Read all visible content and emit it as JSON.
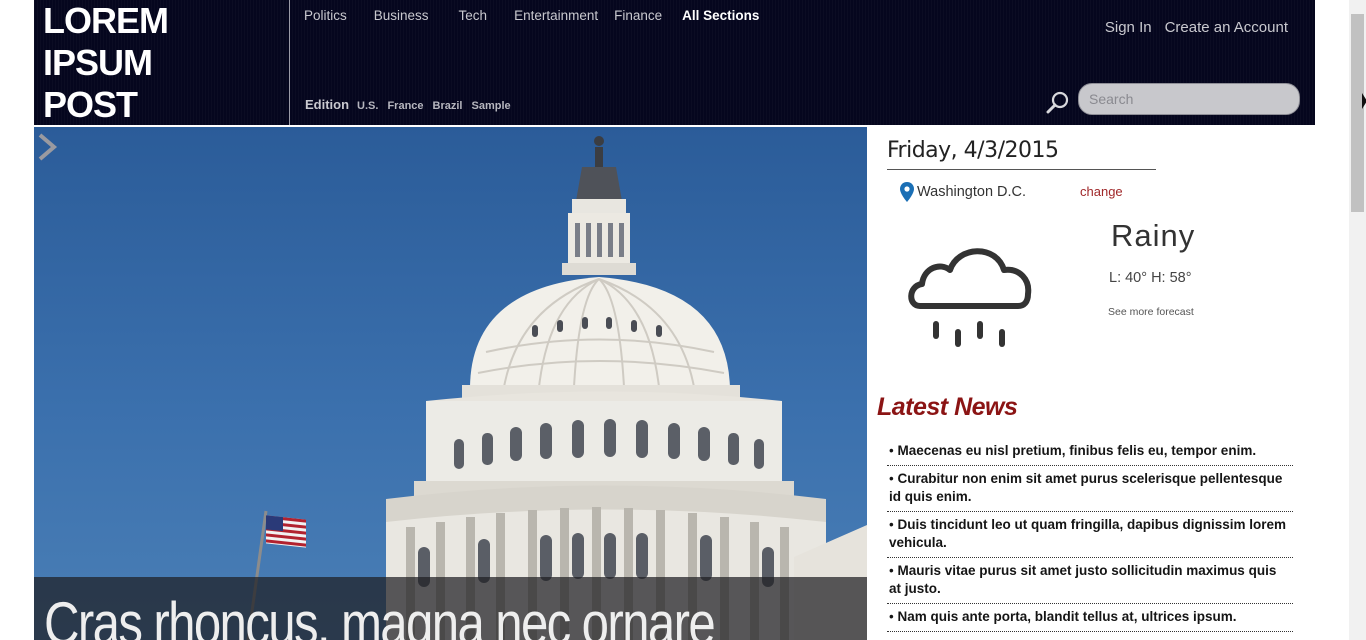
{
  "header": {
    "logo_lines": [
      "LOREM",
      "IPSUM",
      "POST"
    ],
    "nav": [
      "Politics",
      "Business",
      "Tech",
      "Entertainment",
      "Finance",
      "All Sections"
    ],
    "edition": {
      "label": "Edition",
      "items": [
        "U.S.",
        "France",
        "Brazil",
        "Sample"
      ]
    },
    "account": {
      "sign_in": "Sign In",
      "create": "Create an Account"
    },
    "search": {
      "placeholder": "Search"
    }
  },
  "hero": {
    "title": "Cras rhoncus, magna nec ornare",
    "colors": {
      "sky": "#3a6fac",
      "caption_bg": "#1e1e22"
    }
  },
  "sidebar": {
    "date": "Friday, 4/3/2015",
    "location": "Washington D.C.",
    "change": "change",
    "weather": {
      "icon": "rain-cloud-icon",
      "condition": "Rainy",
      "temps": "L: 40° H: 58°",
      "forecast_link": "See more forecast"
    },
    "latest": {
      "title": "Latest News",
      "items": [
        "Maecenas eu nisl pretium, finibus felis eu, tempor enim.",
        "Curabitur non enim sit amet purus scelerisque pellentesque id quis enim.",
        "Duis tincidunt leo ut quam fringilla, dapibus dignissim lorem vehicula.",
        "Mauris vitae purus sit amet justo sollicitudin maximus quis at justo.",
        "Nam quis ante porta, blandit tellus at, ultrices ipsum."
      ]
    }
  },
  "colors": {
    "header_bg": "#05061e",
    "accent_red": "#8b1414",
    "link_red": "#a0282a"
  }
}
